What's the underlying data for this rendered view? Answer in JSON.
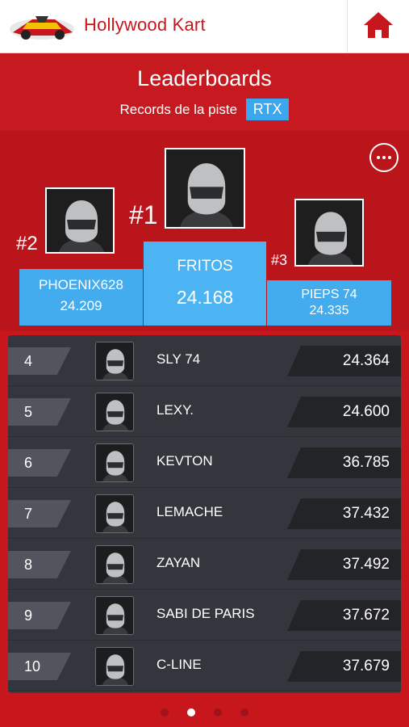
{
  "app": {
    "title": "Hollywood Kart"
  },
  "header": {
    "title": "Leaderboards",
    "subtitle": "Records de la piste",
    "track": "RTX"
  },
  "podium": {
    "first": {
      "rank": "#1",
      "name": "FRITOS",
      "time": "24.168"
    },
    "second": {
      "rank": "#2",
      "name": "PHOENIX628",
      "time": "24.209"
    },
    "third": {
      "rank": "#3",
      "name": "PIEPS 74",
      "time": "24.335"
    }
  },
  "leaderboard": [
    {
      "rank": "4",
      "name": "SLY 74",
      "time": "24.364"
    },
    {
      "rank": "5",
      "name": "LEXY.",
      "time": "24.600"
    },
    {
      "rank": "6",
      "name": "KEVTON",
      "time": "36.785"
    },
    {
      "rank": "7",
      "name": "LEMACHE",
      "time": "37.432"
    },
    {
      "rank": "8",
      "name": "ZAYAN",
      "time": "37.492"
    },
    {
      "rank": "9",
      "name": "SABI DE PARIS",
      "time": "37.672"
    },
    {
      "rank": "10",
      "name": "C-LINE",
      "time": "37.679"
    }
  ],
  "pagination": {
    "pages": 4,
    "current": 2
  },
  "colors": {
    "brand_red": "#c8161d",
    "accent_blue": "#42acef",
    "table_bg": "#34363d"
  },
  "icons": {
    "home": "home-icon",
    "more": "more-options-icon",
    "avatar": "helmet-avatar-icon"
  }
}
